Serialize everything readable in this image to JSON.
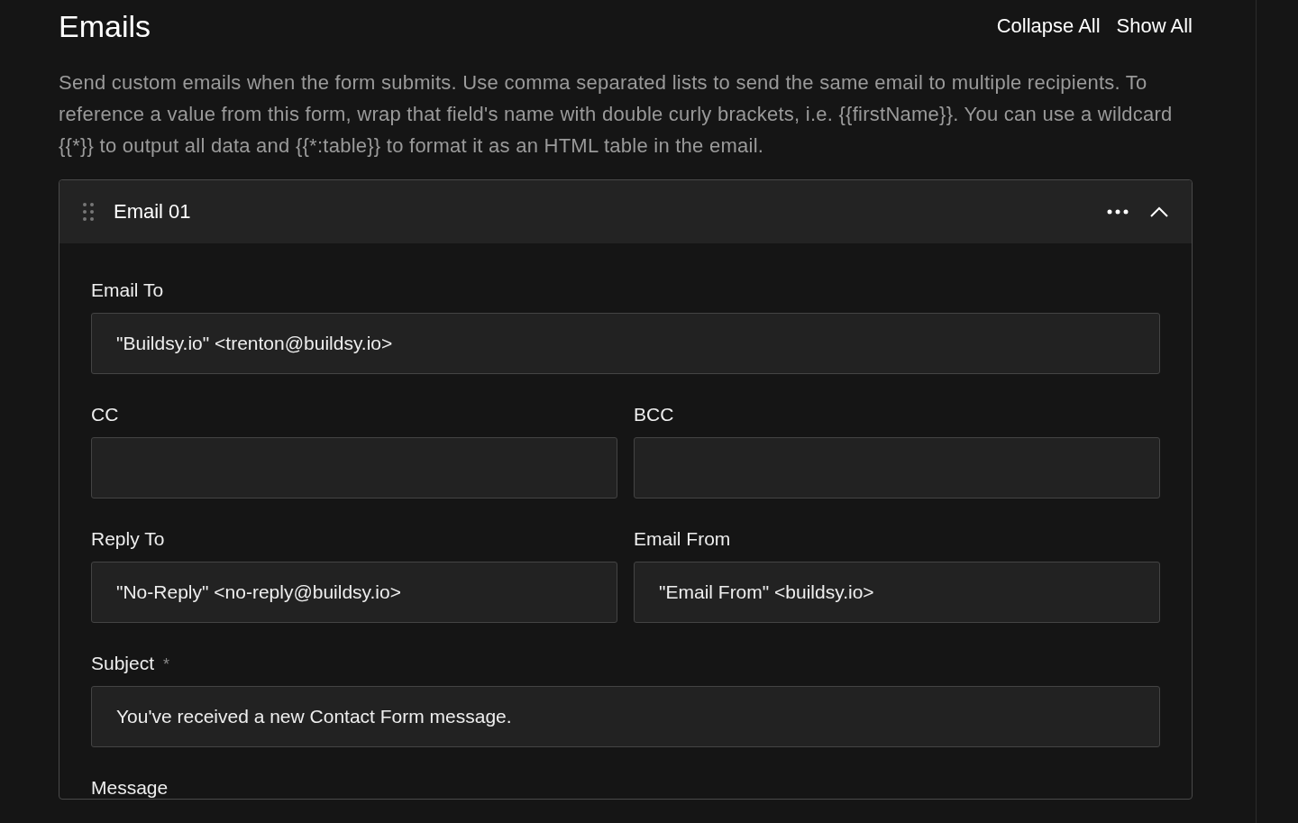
{
  "section": {
    "title": "Emails",
    "actions": [
      "Collapse All",
      "Show All"
    ],
    "description": "Send custom emails when the form submits. Use comma separated lists to send the same email to multiple recipients. To reference a value from this form, wrap that field's name with double curly brackets, i.e. {{firstName}}. You can use a wildcard {{*}} to output all data and {{*:table}} to format it as an HTML table in the email."
  },
  "email": {
    "title": "Email 01",
    "expanded": true,
    "rows": [
      [
        {
          "label": "Email To",
          "value": "\"Buildsy.io\" <trenton@buildsy.io>",
          "required": false
        }
      ],
      [
        {
          "label": "CC",
          "required": false
        },
        {
          "label": "BCC",
          "required": false
        }
      ],
      [
        {
          "label": "Reply To",
          "value": "\"No-Reply\" <no-reply@buildsy.io>",
          "required": false
        },
        {
          "label": "Email From",
          "value": "\"Email From\" <buildsy.io>",
          "required": false
        }
      ],
      [
        {
          "label": "Subject",
          "value": "You've received a new Contact Form message.",
          "required": true,
          "required_mark": "*"
        }
      ],
      [
        {
          "label": "Message",
          "required": false
        }
      ]
    ]
  }
}
